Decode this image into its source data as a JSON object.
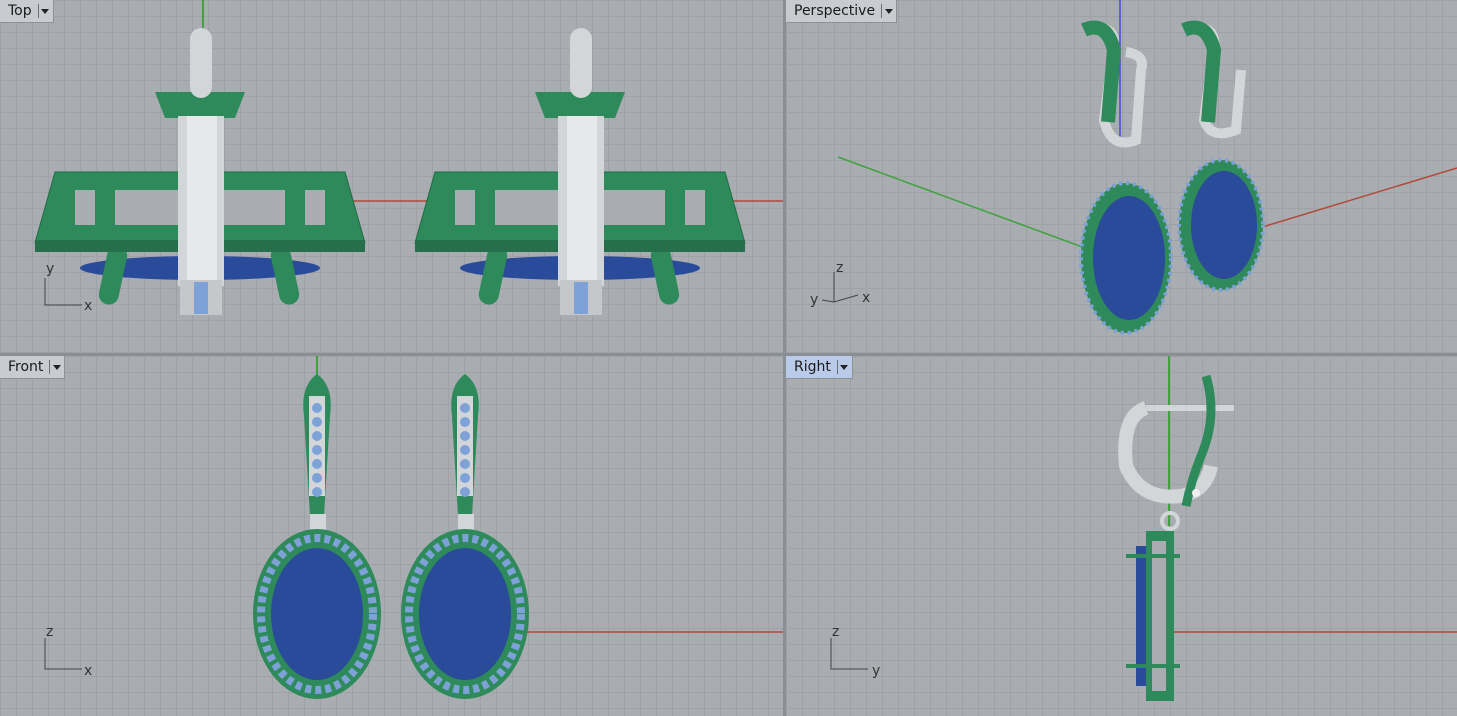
{
  "viewports": {
    "top": {
      "label": "Top"
    },
    "perspective": {
      "label": "Perspective"
    },
    "front": {
      "label": "Front"
    },
    "right": {
      "label": "Right"
    }
  },
  "axis_labels": {
    "top": {
      "h": "x",
      "v": "y"
    },
    "perspective": {
      "x": "x",
      "y": "y",
      "z": "z"
    },
    "front": {
      "h": "x",
      "v": "z"
    },
    "right": {
      "h": "y",
      "v": "z"
    }
  },
  "colors": {
    "metal_green": "#2e8a5a",
    "metal_silver": "#d3d6d8",
    "gem_blue": "#2a4a9a",
    "accent_stone": "#7ea2d8",
    "x_axis": "#b24a3a",
    "y_axis": "#3fa23f",
    "z_axis": "#4a4ad0"
  }
}
